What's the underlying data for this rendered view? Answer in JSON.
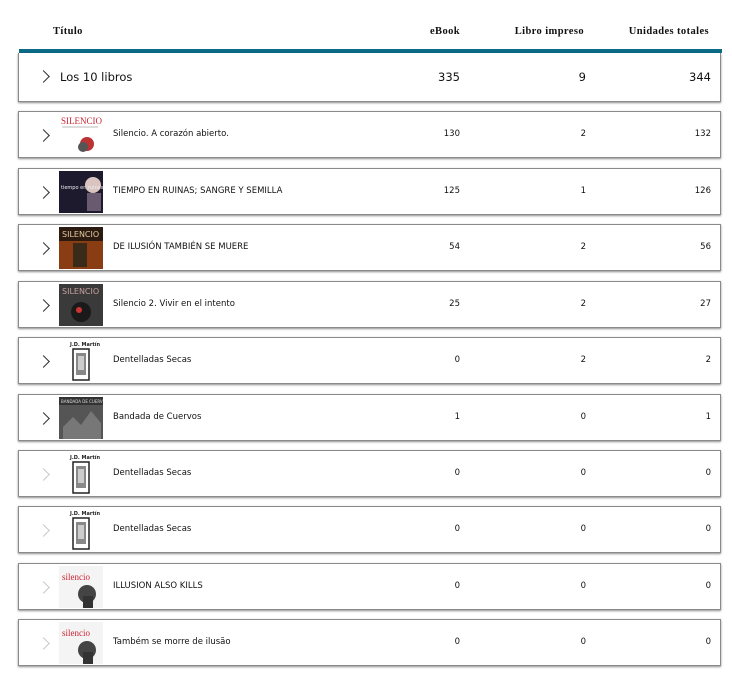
{
  "header": {
    "title": "Título",
    "ebook": "eBook",
    "print": "Libro impreso",
    "total": "Unidades totales"
  },
  "summary": {
    "label": "Los 10 libros",
    "ebook": "335",
    "print": "9",
    "total": "344"
  },
  "books": [
    {
      "title": "Silencio. A corazón abierto.",
      "ebook": "130",
      "print": "2",
      "total": "132",
      "cover": "silencio-red",
      "chevron": "dark"
    },
    {
      "title": "TIEMPO EN RUINAS; SANGRE Y SEMILLA",
      "ebook": "125",
      "print": "1",
      "total": "126",
      "cover": "tiempo",
      "chevron": "dark"
    },
    {
      "title": "DE ILUSIÓN TAMBIÉN SE MUERE",
      "ebook": "54",
      "print": "2",
      "total": "56",
      "cover": "ilusion",
      "chevron": "dark"
    },
    {
      "title": "Silencio 2. Vivir en el intento",
      "ebook": "25",
      "print": "2",
      "total": "27",
      "cover": "silencio2",
      "chevron": "dark"
    },
    {
      "title": "Dentelladas Secas",
      "ebook": "0",
      "print": "2",
      "total": "2",
      "cover": "dentelladas",
      "chevron": "dark"
    },
    {
      "title": "Bandada de Cuervos",
      "ebook": "1",
      "print": "0",
      "total": "1",
      "cover": "cuervos",
      "chevron": "dark"
    },
    {
      "title": "Dentelladas Secas",
      "ebook": "0",
      "print": "0",
      "total": "0",
      "cover": "dentelladas",
      "chevron": "light"
    },
    {
      "title": "Dentelladas Secas",
      "ebook": "0",
      "print": "0",
      "total": "0",
      "cover": "dentelladas",
      "chevron": "light"
    },
    {
      "title": "ILLUSION ALSO KILLS",
      "ebook": "0",
      "print": "0",
      "total": "0",
      "cover": "silencio-white",
      "chevron": "light"
    },
    {
      "title": "Também se morre de ilusão",
      "ebook": "0",
      "print": "0",
      "total": "0",
      "cover": "silencio-white",
      "chevron": "light"
    }
  ],
  "cover_text": {
    "silencio": "SILENCIO",
    "silencio_lower": "silencio",
    "author": "J.D. Martín",
    "tiempo": "tiempo en ruinas",
    "cuervos": "BANDADA DE CUERVOS"
  },
  "colors": {
    "accent": "#0b6a86",
    "cover_red": "#cc2233"
  }
}
